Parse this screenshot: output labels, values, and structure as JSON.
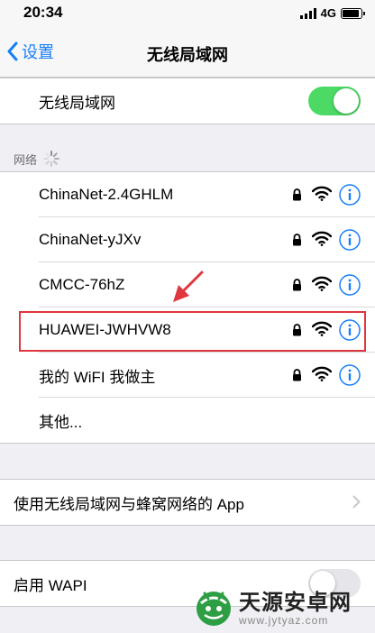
{
  "status_bar": {
    "time": "20:34",
    "network_type": "4G",
    "signal_bars": 4,
    "battery_level": 0.9
  },
  "nav": {
    "back_label": "设置",
    "title": "无线局域网"
  },
  "wifi_toggle": {
    "label": "无线局域网",
    "on": true
  },
  "section": {
    "header": "网络"
  },
  "networks": [
    {
      "name": "ChinaNet-2.4GHLM",
      "locked": true,
      "highlighted": false
    },
    {
      "name": "ChinaNet-yJXv",
      "locked": true,
      "highlighted": false
    },
    {
      "name": "CMCC-76hZ",
      "locked": true,
      "highlighted": false
    },
    {
      "name": "HUAWEI-JWHVW8",
      "locked": true,
      "highlighted": true
    },
    {
      "name": "我的 WiFI 我做主",
      "locked": true,
      "highlighted": false
    }
  ],
  "other_label": "其他...",
  "apps_row": {
    "label": "使用无线局域网与蜂窝网络的 App"
  },
  "wapi_row": {
    "label": "启用 WAPI",
    "on": false
  },
  "watermark": {
    "title": "天源安卓网",
    "url": "www.jytyaz.com"
  },
  "colors": {
    "accent": "#157efb",
    "toggle_on": "#4cd964",
    "highlight": "#e0363f"
  }
}
